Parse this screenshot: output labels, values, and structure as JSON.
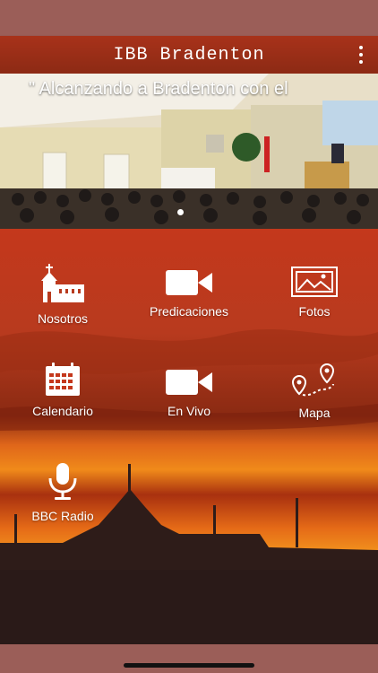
{
  "app": {
    "title": "IBB Bradenton"
  },
  "banner": {
    "caption": "\" Alcanzando a Bradenton con el"
  },
  "menu": {
    "items": [
      {
        "label": "Nosotros",
        "icon": "church-icon"
      },
      {
        "label": "Predicaciones",
        "icon": "video-camera-icon"
      },
      {
        "label": "Fotos",
        "icon": "photo-gallery-icon"
      },
      {
        "label": "Calendario",
        "icon": "calendar-icon"
      },
      {
        "label": "En Vivo",
        "icon": "video-camera-icon"
      },
      {
        "label": "Mapa",
        "icon": "map-pins-icon"
      },
      {
        "label": "BBC Radio",
        "icon": "microphone-icon"
      }
    ]
  },
  "colors": {
    "app_bar": "#a8321a",
    "status_bar": "#9b5e58",
    "sky_top": "#c4381c",
    "sky_glow": "#f08a1a"
  }
}
